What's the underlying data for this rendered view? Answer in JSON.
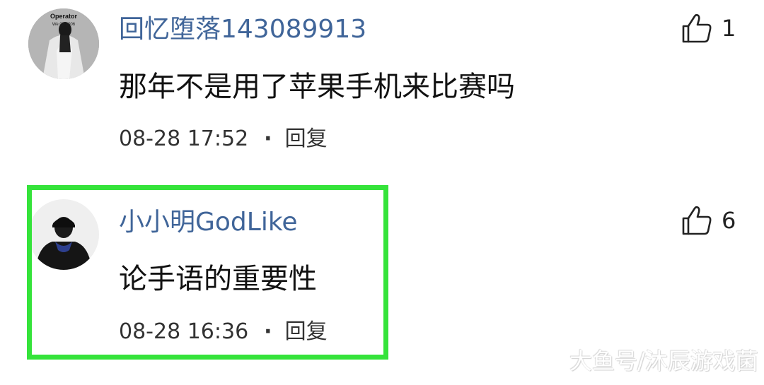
{
  "comments": [
    {
      "username": "回忆堕落143089913",
      "content": "那年不是用了苹果手机来比赛吗",
      "time": "08-28 17:52",
      "separator": "·",
      "reply_label": "回复",
      "likes": "1",
      "avatar_text": "Operator",
      "avatar_subtext": "We 03 2006",
      "highlighted": false
    },
    {
      "username": "小小明GodLike",
      "content": "论手语的重要性",
      "time": "08-28 16:36",
      "separator": "·",
      "reply_label": "回复",
      "likes": "6",
      "highlighted": true
    }
  ],
  "icons": {
    "like": "thumbs-up-icon"
  },
  "colors": {
    "username": "#406599",
    "highlight_border": "#35e33a"
  },
  "watermark": "大鱼号/沐辰游戏菌"
}
